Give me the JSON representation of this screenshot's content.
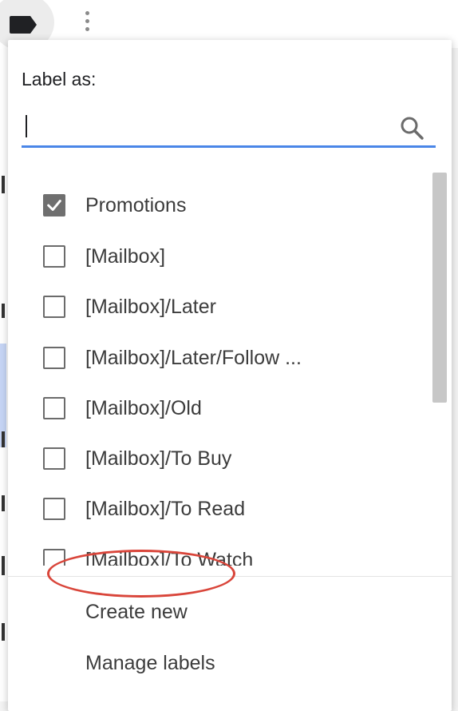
{
  "menu": {
    "title": "Label as:",
    "search": {
      "value": "",
      "placeholder": ""
    },
    "items": [
      {
        "label": "Promotions",
        "checked": true
      },
      {
        "label": "[Mailbox]",
        "checked": false
      },
      {
        "label": "[Mailbox]/Later",
        "checked": false
      },
      {
        "label": "[Mailbox]/Later/Follow ...",
        "checked": false
      },
      {
        "label": "[Mailbox]/Old",
        "checked": false
      },
      {
        "label": "[Mailbox]/To Buy",
        "checked": false
      },
      {
        "label": "[Mailbox]/To Read",
        "checked": false
      },
      {
        "label": "[Mailbox]/To Watch",
        "checked": false
      }
    ],
    "actions": {
      "create_new": "Create new",
      "manage_labels": "Manage labels"
    }
  },
  "colors": {
    "accent": "#4a86e8",
    "annotation": "#d9453a",
    "checked_box": "#6f6f6f"
  },
  "icons": [
    "label-icon",
    "more-vert-icon",
    "search-icon",
    "check-icon"
  ]
}
